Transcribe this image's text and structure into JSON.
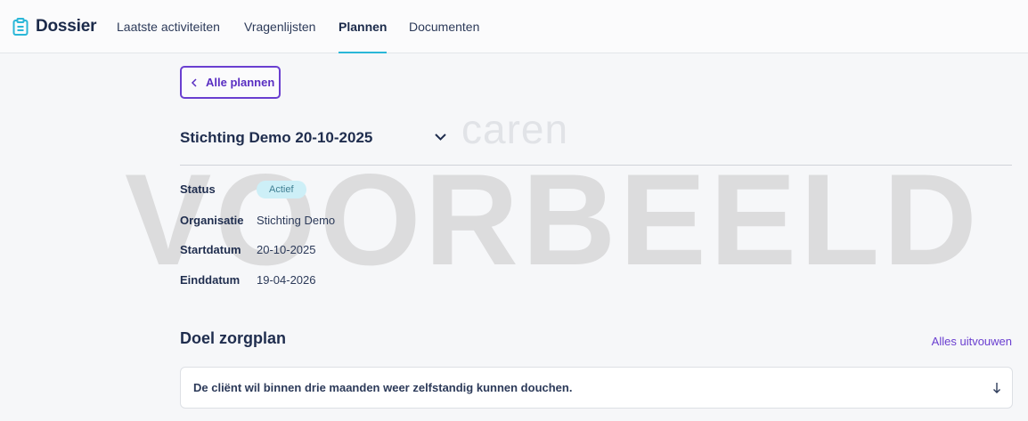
{
  "header": {
    "brand": "Dossier",
    "tabs": [
      {
        "label": "Laatste activiteiten",
        "active": false
      },
      {
        "label": "Vragenlijsten",
        "active": false
      },
      {
        "label": "Plannen",
        "active": true
      },
      {
        "label": "Documenten",
        "active": false
      }
    ]
  },
  "back_button": {
    "label": "Alle plannen"
  },
  "plan": {
    "title": "Stichting Demo 20-10-2025",
    "logo_text": "caren",
    "watermark": "VOORBEELD"
  },
  "details": {
    "status_label": "Status",
    "status_value": "Actief",
    "organisation_label": "Organisatie",
    "organisation_value": "Stichting Demo",
    "start_label": "Startdatum",
    "start_value": "20-10-2025",
    "end_label": "Einddatum",
    "end_value": "19-04-2026"
  },
  "goals": {
    "title": "Doel zorgplan",
    "expand_all": "Alles uitvouwen",
    "items": [
      {
        "text": "De cliënt wil binnen drie maanden weer zelfstandig kunnen douchen."
      }
    ]
  },
  "colors": {
    "accent": "#6a3fd0",
    "tab_underline": "#2ab7d8",
    "badge_bg": "#cdeff7"
  }
}
